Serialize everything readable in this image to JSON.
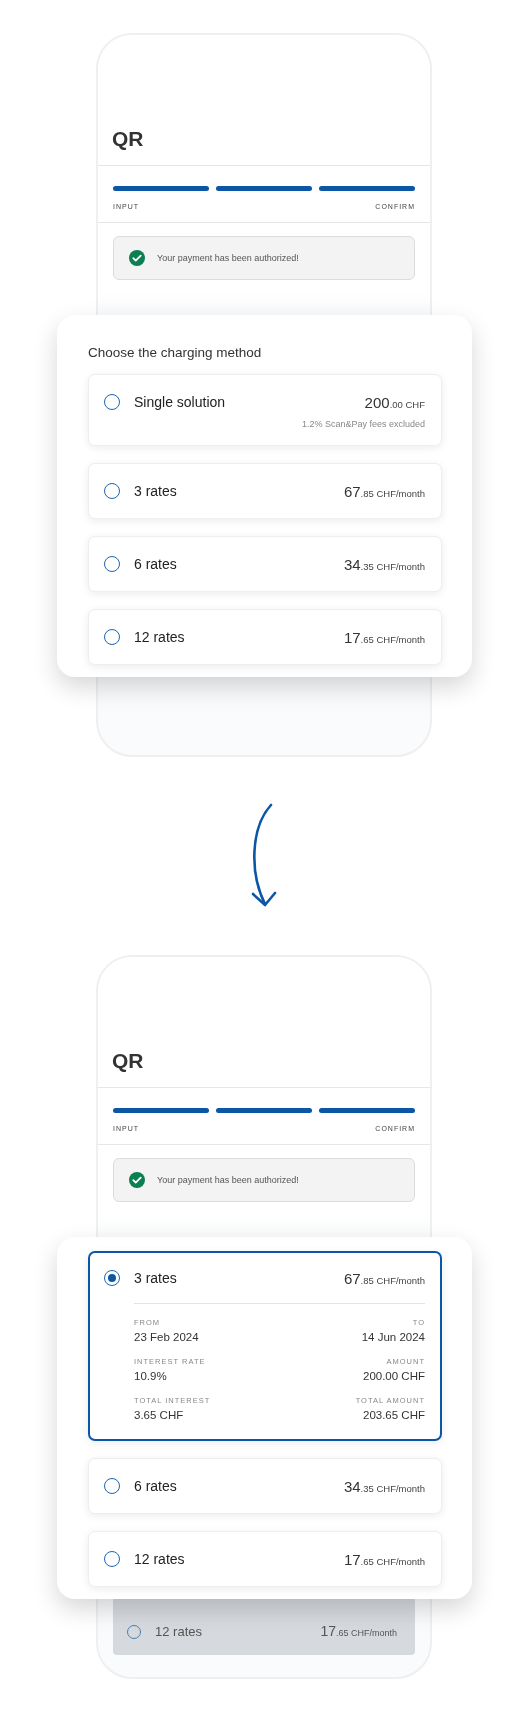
{
  "screens": [
    {
      "phone": {
        "title": "QR",
        "progress": [
          {
            "done": true
          },
          {
            "done": true
          },
          {
            "done": true
          }
        ],
        "step_start": "INPUT",
        "step_end": "CONFIRM",
        "alert": "Your payment has been authorized!"
      },
      "panel": {
        "heading": "Choose the charging method",
        "options": [
          {
            "label": "Single solution",
            "amount": "200",
            "amount_suffix": ".00 CHF",
            "note": "1.2% Scan&Pay fees excluded",
            "selected": false
          },
          {
            "label": "3 rates",
            "amount": "67",
            "amount_suffix": ".85 CHF/month",
            "selected": false
          },
          {
            "label": "6 rates",
            "amount": "34",
            "amount_suffix": ".35 CHF/month",
            "selected": false
          },
          {
            "label": "12 rates",
            "amount": "17",
            "amount_suffix": ".65 CHF/month",
            "selected": false
          }
        ]
      }
    },
    {
      "phone": {
        "title": "QR",
        "progress": [
          {
            "done": true
          },
          {
            "done": true
          },
          {
            "done": true
          }
        ],
        "step_start": "INPUT",
        "step_end": "CONFIRM",
        "alert": "Your payment has been authorized!",
        "behind_option": {
          "label": "12 rates",
          "amount": "17",
          "amount_suffix": ".65 CHF/month",
          "selected": false
        }
      },
      "panel": {
        "options": [
          {
            "label": "3 rates",
            "amount": "67",
            "amount_suffix": ".85 CHF/month",
            "selected": true,
            "details": [
              {
                "label": "FROM",
                "value": "23 Feb 2024"
              },
              {
                "label": "TO",
                "value": "14 Jun 2024"
              },
              {
                "label": "INTEREST RATE",
                "value": "10.9%"
              },
              {
                "label": "AMOUNT",
                "value": "200.00 CHF"
              },
              {
                "label": "TOTAL INTEREST",
                "value": "3.65 CHF"
              },
              {
                "label": "TOTAL AMOUNT",
                "value": "203.65 CHF"
              }
            ]
          },
          {
            "label": "6 rates",
            "amount": "34",
            "amount_suffix": ".35 CHF/month",
            "selected": false
          },
          {
            "label": "12 rates",
            "amount": "17",
            "amount_suffix": ".65 CHF/month",
            "selected": false
          }
        ]
      }
    }
  ]
}
